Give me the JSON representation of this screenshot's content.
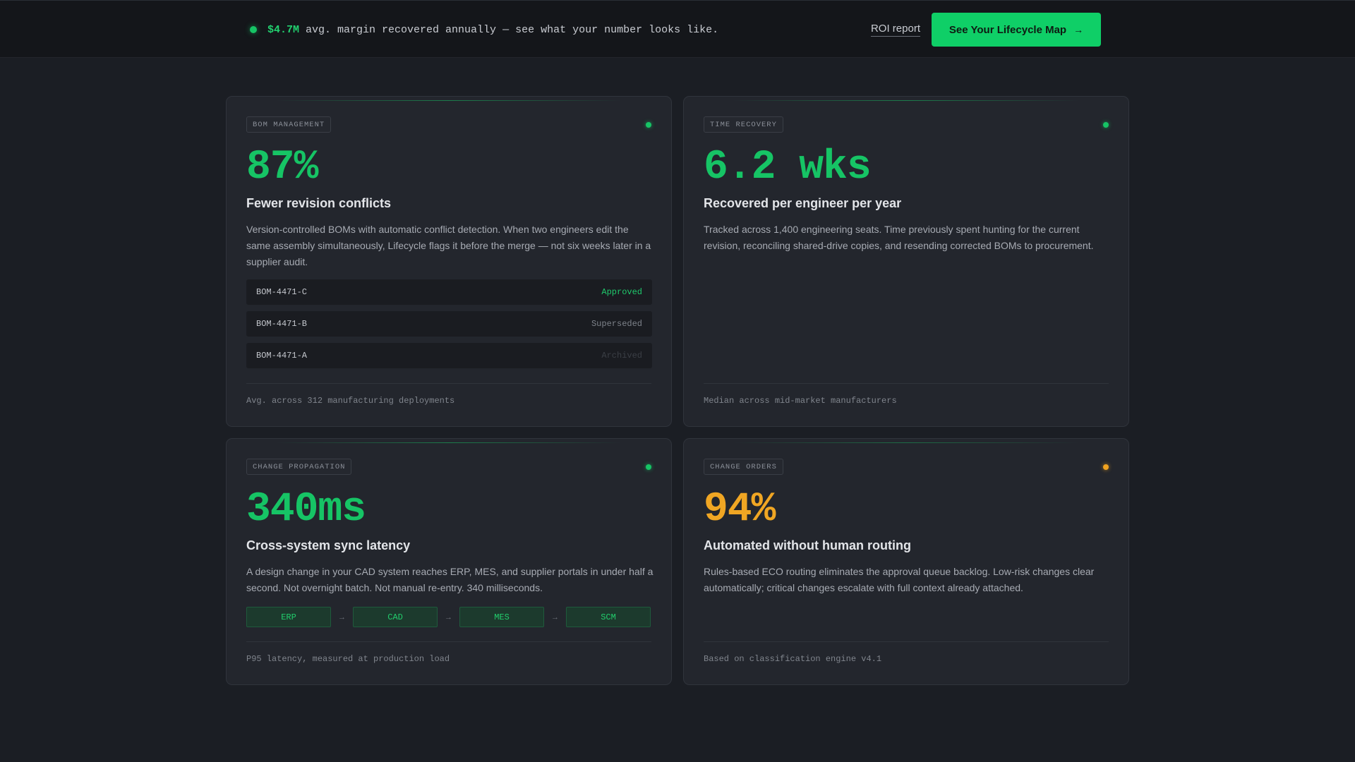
{
  "banner": {
    "highlight": "$4.7M",
    "text": " avg. margin recovered annually — see what your number looks like.",
    "roi_link": "ROI report",
    "cta_label": "See Your Lifecycle Map",
    "cta_arrow": "→"
  },
  "cards": {
    "bom": {
      "tag": "BOM MANAGEMENT",
      "metric": "87%",
      "title": "Fewer revision conflicts",
      "description": "Version-controlled BOMs with automatic conflict detection. When two engineers edit the same assembly simultaneously, Lifecycle flags it before the merge — not six weeks later in a supplier audit.",
      "rows": [
        {
          "id": "BOM-4471-C",
          "status": "Approved"
        },
        {
          "id": "BOM-4471-B",
          "status": "Superseded"
        },
        {
          "id": "BOM-4471-A",
          "status": "Archived"
        }
      ],
      "footnote": "Avg. across 312 manufacturing deployments"
    },
    "time": {
      "tag": "TIME RECOVERY",
      "metric": "6.2 wks",
      "title": "Recovered per engineer per year",
      "description": "Tracked across 1,400 engineering seats. Time previously spent hunting for the current revision, reconciling shared-drive copies, and resending corrected BOMs to procurement.",
      "footnote": "Median across mid-market manufacturers"
    },
    "propagation": {
      "tag": "CHANGE PROPAGATION",
      "metric": "340ms",
      "title": "Cross-system sync latency",
      "description": "A design change in your CAD system reaches ERP, MES, and supplier portals in under half a second. Not overnight batch. Not manual re-entry. 340 milliseconds.",
      "pipeline": [
        "ERP",
        "CAD",
        "MES",
        "SCM"
      ],
      "arrow": "→",
      "footnote": "P95 latency, measured at production load"
    },
    "eco": {
      "tag": "CHANGE ORDERS",
      "metric": "94%",
      "title": "Automated without human routing",
      "description": "Rules-based ECO routing eliminates the approval queue backlog. Low-risk changes clear automatically; critical changes escalate with full context already attached.",
      "footnote": "Based on classification engine v4.1"
    }
  },
  "colors": {
    "accent_green": "#16c465",
    "accent_amber": "#f0a623",
    "background": "#1b1e24",
    "card": "#23262d"
  }
}
